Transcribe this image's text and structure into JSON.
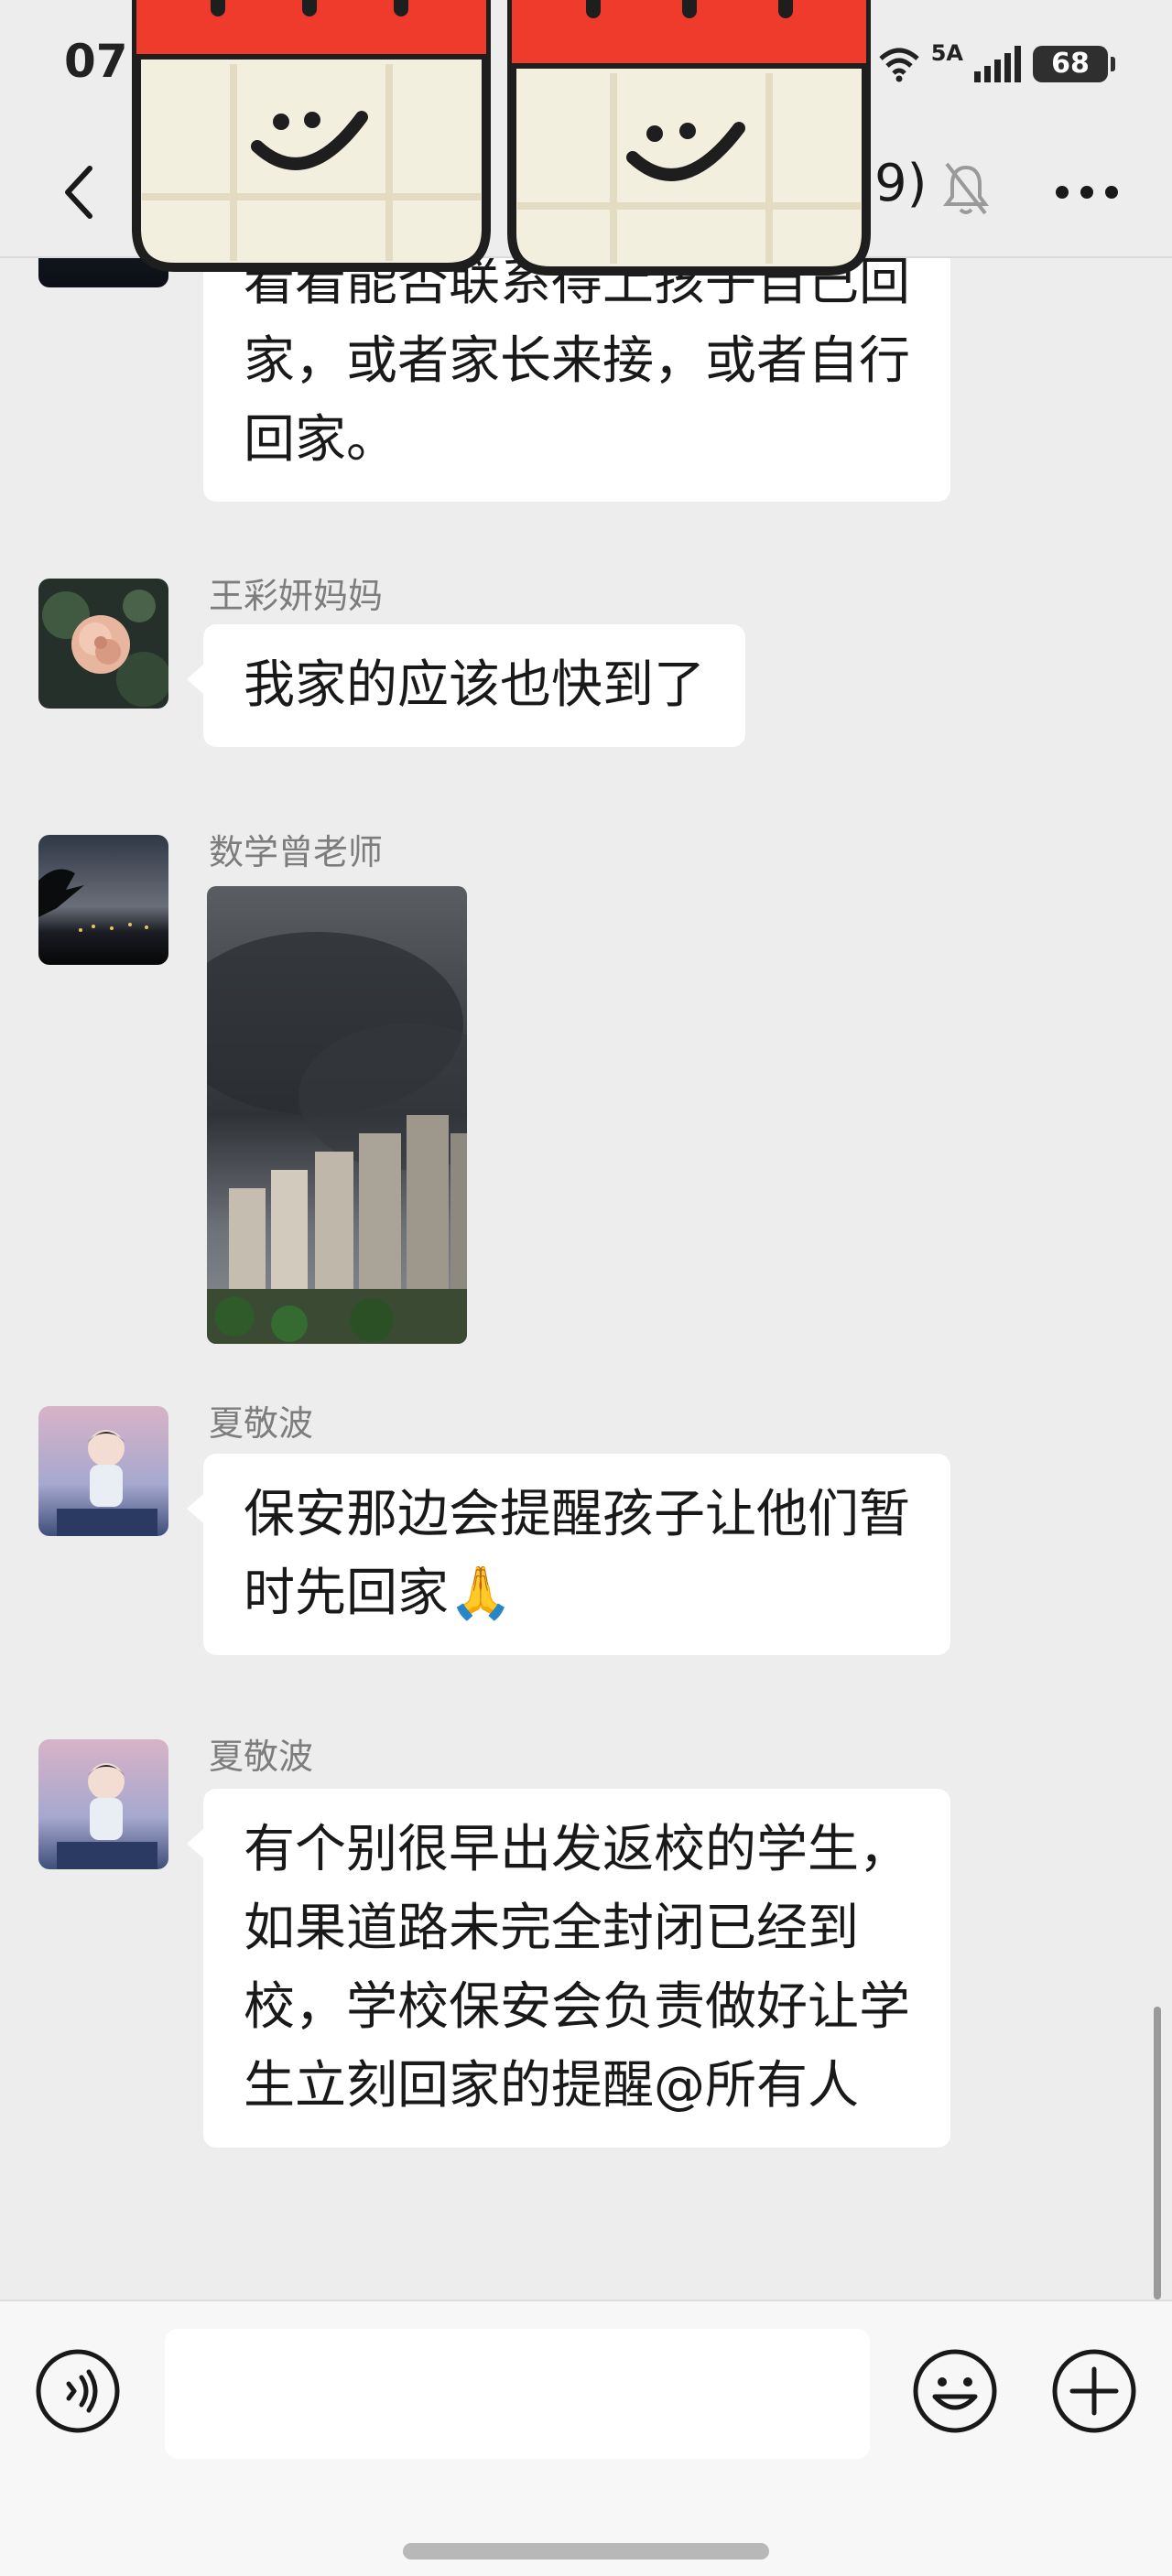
{
  "status_bar": {
    "time": "07",
    "network_label": "5A",
    "battery_level": "68"
  },
  "nav_bar": {
    "title_fragment": "9)"
  },
  "stickers": [
    {
      "name": "calendar-smile-sticker"
    },
    {
      "name": "calendar-smile-sticker"
    }
  ],
  "messages": [
    {
      "type": "text",
      "text": "看看能否联系得上孩子自己回家，或者家长来接，或者自行回家。"
    },
    {
      "type": "text",
      "sender": "王彩妍妈妈",
      "text": "我家的应该也快到了"
    },
    {
      "type": "image",
      "sender": "数学曾老师",
      "image_description_icon": "smoke-over-buildings-photo"
    },
    {
      "type": "text",
      "sender": "夏敬波",
      "text": "保安那边会提醒孩子让他们暂时先回家🙏"
    },
    {
      "type": "text",
      "sender": "夏敬波",
      "text": "有个别很早出发返校的学生，如果道路未完全封闭已经到校，学校保安会负责做好让学生立刻回家的提醒@所有人"
    }
  ],
  "input_bar": {
    "placeholder": "",
    "value": ""
  },
  "icons": {
    "back": "back-arrow-icon",
    "mute": "mute-bell-icon",
    "more": "more-dots-icon",
    "voice": "voice-icon",
    "emoji": "emoji-icon",
    "add": "plus-circle-icon"
  },
  "colors": {
    "background": "#ededed",
    "bubble": "#ffffff",
    "sender_name": "#7d7d7d",
    "sticker_red": "#ee3b2c"
  }
}
